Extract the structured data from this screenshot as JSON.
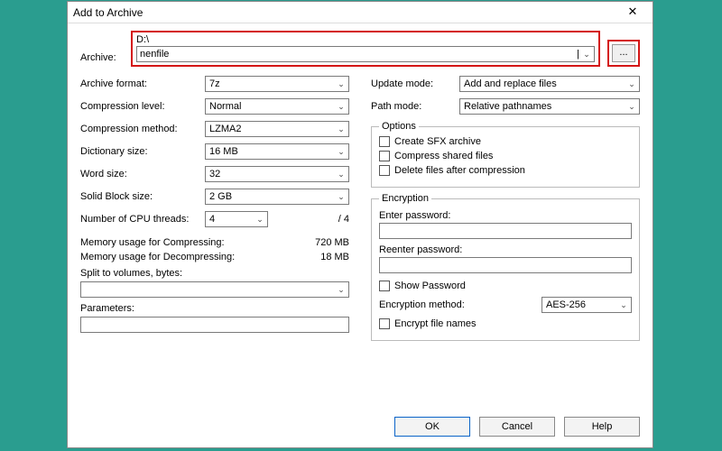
{
  "window": {
    "title": "Add to Archive",
    "close": "✕"
  },
  "archive": {
    "label": "Archive:",
    "path": "D:\\",
    "filename": "nenfile",
    "browse": "..."
  },
  "left": {
    "archive_format": {
      "label": "Archive format:",
      "value": "7z"
    },
    "compression_level": {
      "label": "Compression level:",
      "value": "Normal"
    },
    "compression_method": {
      "label": "Compression method:",
      "value": "LZMA2"
    },
    "dictionary_size": {
      "label": "Dictionary size:",
      "value": "16 MB"
    },
    "word_size": {
      "label": "Word size:",
      "value": "32"
    },
    "solid_block_size": {
      "label": "Solid Block size:",
      "value": "2 GB"
    },
    "cpu_threads": {
      "label": "Number of CPU threads:",
      "value": "4",
      "suffix": "/ 4"
    },
    "mem_compress": {
      "label": "Memory usage for Compressing:",
      "value": "720 MB"
    },
    "mem_decompress": {
      "label": "Memory usage for Decompressing:",
      "value": "18 MB"
    },
    "split_label": "Split to volumes, bytes:",
    "split_value": "",
    "parameters_label": "Parameters:",
    "parameters_value": ""
  },
  "right": {
    "update_mode": {
      "label": "Update mode:",
      "value": "Add and replace files"
    },
    "path_mode": {
      "label": "Path mode:",
      "value": "Relative pathnames"
    },
    "options": {
      "legend": "Options",
      "sfx": "Create SFX archive",
      "shared": "Compress shared files",
      "delete_after": "Delete files after compression"
    },
    "encryption": {
      "legend": "Encryption",
      "enter_pw": "Enter password:",
      "reenter_pw": "Reenter password:",
      "show_pw": "Show Password",
      "method_label": "Encryption method:",
      "method_value": "AES-256",
      "encrypt_names": "Encrypt file names"
    }
  },
  "buttons": {
    "ok": "OK",
    "cancel": "Cancel",
    "help": "Help"
  },
  "glyph": {
    "chevron": "⌄"
  }
}
